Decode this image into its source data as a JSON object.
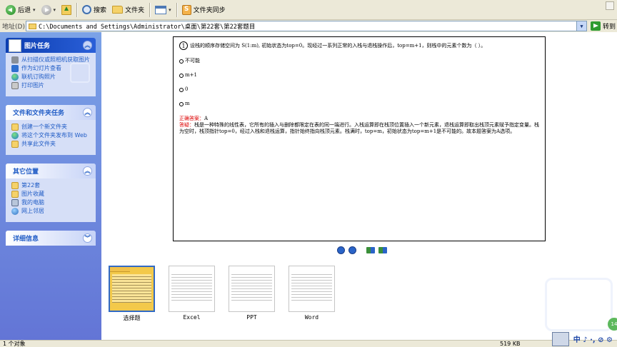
{
  "toolbar": {
    "back_label": "后退",
    "search_label": "搜索",
    "folders_label": "文件夹",
    "sync_label": "文件夹同步"
  },
  "address": {
    "label": "地址(D)",
    "path": "C:\\Documents and Settings\\Administrator\\桌面\\第22套\\第22套题目",
    "go_label": "转到"
  },
  "left_pane": {
    "picture_tasks": {
      "title": "图片任务",
      "items": [
        "从扫描仪或照相机获取图片",
        "作为幻灯片查看",
        "联机订购照片",
        "打印图片"
      ]
    },
    "file_tasks": {
      "title": "文件和文件夹任务",
      "items": [
        "创建一个新文件夹",
        "将这个文件夹发布到 Web",
        "共享此文件夹"
      ]
    },
    "other_places": {
      "title": "其它位置",
      "items": [
        "第22套",
        "图片收藏",
        "我的电脑",
        "网上邻居"
      ]
    },
    "details": {
      "title": "详细信息"
    }
  },
  "preview": {
    "question_number": "1",
    "question": "设栈的顺序存储空间为 S(1:m), 初始状态为top=0。现经过一系列正常的入栈与退栈操作后，top=m+1，则栈中的元素个数为（ ）。",
    "options": [
      "不可能",
      "m+1",
      "0",
      "m"
    ],
    "answer_label": "正确答案：",
    "answer_value": "A",
    "explanation_label": "答疑：",
    "explanation": "栈是一种特殊的线性表，它所有的插入与删除都限定在表的同一端进行。入栈运算即在栈顶位置插入一个新元素，退栈运算即取出栈顶元素赋予指定变量。栈为空时，栈顶指针top=0，经过入栈和退栈运算，指针始终指向栈顶元素。栈满时，top=m，初始状态为top=m+1是不可能的。故本题答案为A选项。"
  },
  "thumbnails": [
    {
      "label": "选择题",
      "selected": true
    },
    {
      "label": "Excel",
      "selected": false
    },
    {
      "label": "PPT",
      "selected": false
    },
    {
      "label": "Word",
      "selected": false
    }
  ],
  "statusbar": {
    "objects": "1 个对象",
    "size": "519 KB"
  },
  "ime": {
    "text": "中 ♪ ·, ⊘ ⚙"
  },
  "float_badge": "14"
}
